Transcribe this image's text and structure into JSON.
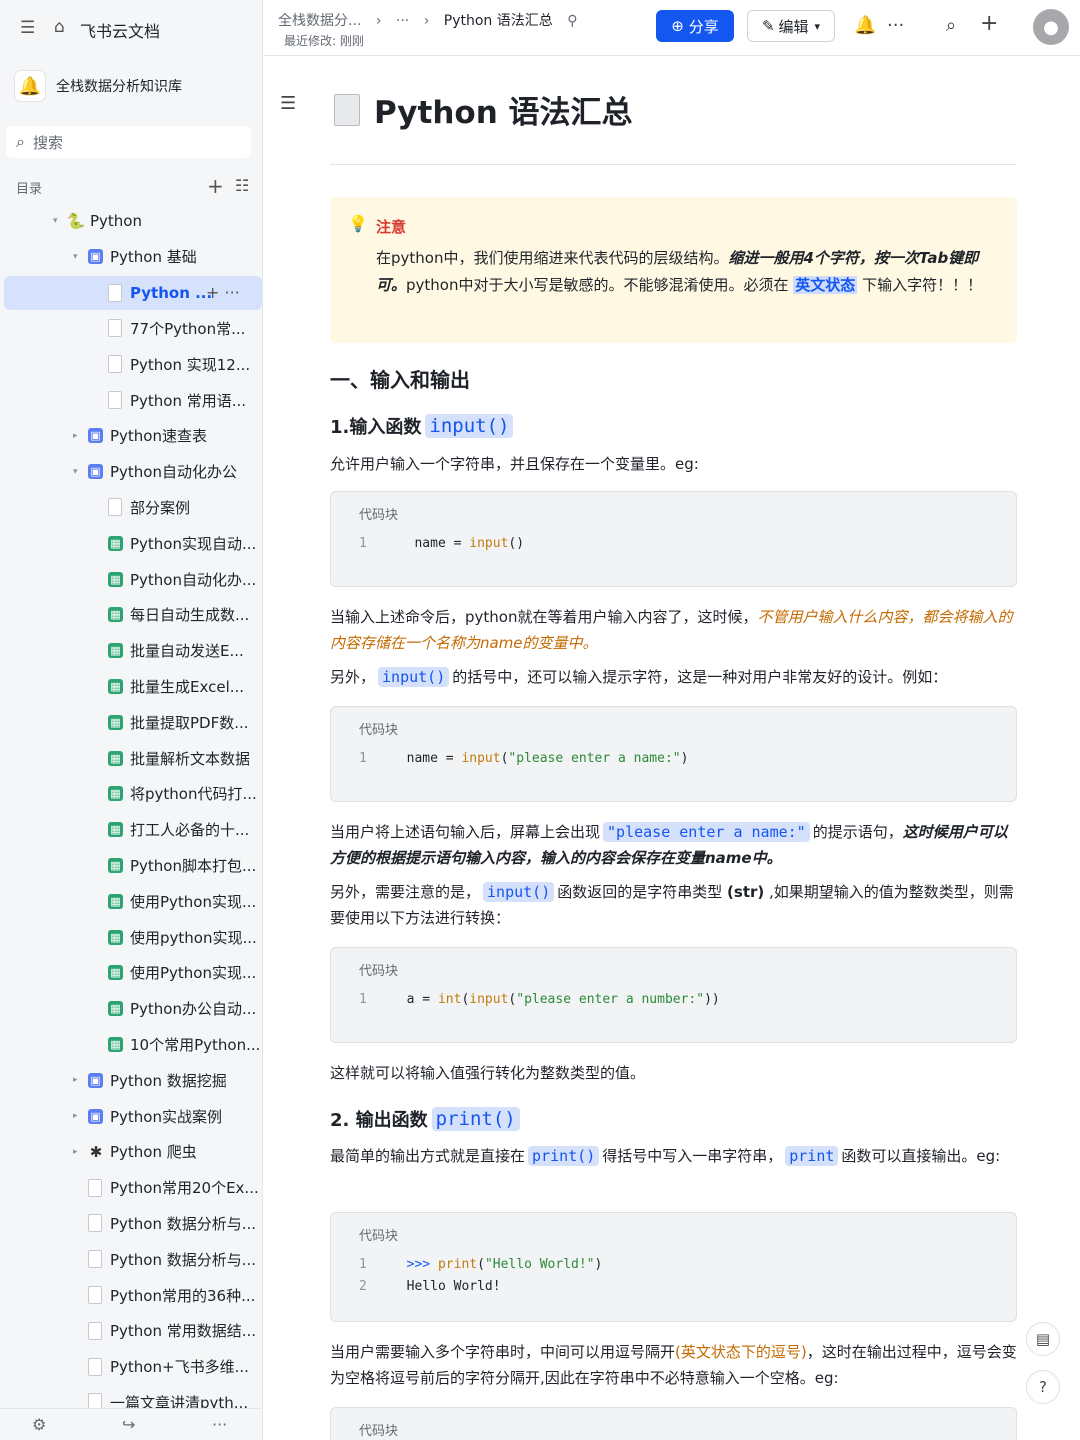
{
  "sidebar": {
    "app_title": "飞书云文档",
    "knowledge_base": "全栈数据分析知识库",
    "search_placeholder": "搜索",
    "toc_label": "目录",
    "tree": [
      {
        "label": "Python",
        "depth": 0,
        "caret": "▾",
        "icon": "snake"
      },
      {
        "label": "Python 基础",
        "depth": 1,
        "caret": "▾",
        "icon": "wiki"
      },
      {
        "label": "Python ...",
        "depth": 2,
        "caret": "",
        "icon": "doc",
        "selected": true
      },
      {
        "label": "77个Python常...",
        "depth": 2,
        "caret": "",
        "icon": "doc"
      },
      {
        "label": "Python 实现12...",
        "depth": 2,
        "caret": "",
        "icon": "doc"
      },
      {
        "label": "Python 常用语...",
        "depth": 2,
        "caret": "",
        "icon": "doc"
      },
      {
        "label": "Python速查表",
        "depth": 1,
        "caret": "▸",
        "icon": "wiki"
      },
      {
        "label": "Python自动化办公",
        "depth": 1,
        "caret": "▾",
        "icon": "wiki"
      },
      {
        "label": "部分案例",
        "depth": 2,
        "caret": "",
        "icon": "doc"
      },
      {
        "label": "Python实现自动...",
        "depth": 2,
        "caret": "",
        "icon": "sheet"
      },
      {
        "label": "Python自动化办...",
        "depth": 2,
        "caret": "",
        "icon": "sheet"
      },
      {
        "label": "每日自动生成数...",
        "depth": 2,
        "caret": "",
        "icon": "sheet"
      },
      {
        "label": "批量自动发送E...",
        "depth": 2,
        "caret": "",
        "icon": "sheet"
      },
      {
        "label": "批量生成Excel...",
        "depth": 2,
        "caret": "",
        "icon": "sheet"
      },
      {
        "label": "批量提取PDF数...",
        "depth": 2,
        "caret": "",
        "icon": "sheet"
      },
      {
        "label": "批量解析文本数据",
        "depth": 2,
        "caret": "",
        "icon": "sheet"
      },
      {
        "label": "将python代码打...",
        "depth": 2,
        "caret": "",
        "icon": "sheet"
      },
      {
        "label": "打工人必备的十...",
        "depth": 2,
        "caret": "",
        "icon": "sheet"
      },
      {
        "label": "Python脚本打包...",
        "depth": 2,
        "caret": "",
        "icon": "sheet"
      },
      {
        "label": "使用Python实现...",
        "depth": 2,
        "caret": "",
        "icon": "sheet"
      },
      {
        "label": "使用python实现...",
        "depth": 2,
        "caret": "",
        "icon": "sheet"
      },
      {
        "label": "使用Python实现...",
        "depth": 2,
        "caret": "",
        "icon": "sheet"
      },
      {
        "label": "Python办公自动...",
        "depth": 2,
        "caret": "",
        "icon": "sheet"
      },
      {
        "label": "10个常用Python...",
        "depth": 2,
        "caret": "",
        "icon": "sheet"
      },
      {
        "label": "Python 数据挖掘",
        "depth": 1,
        "caret": "▸",
        "icon": "wiki"
      },
      {
        "label": "Python实战案例",
        "depth": 1,
        "caret": "▸",
        "icon": "wiki"
      },
      {
        "label": "Python 爬虫",
        "depth": 1,
        "caret": "▸",
        "icon": "spider"
      },
      {
        "label": "Python常用20个Ex...",
        "depth": 1,
        "caret": "",
        "icon": "doc"
      },
      {
        "label": "Python 数据分析与...",
        "depth": 1,
        "caret": "",
        "icon": "doc"
      },
      {
        "label": "Python 数据分析与...",
        "depth": 1,
        "caret": "",
        "icon": "doc"
      },
      {
        "label": "Python常用的36种...",
        "depth": 1,
        "caret": "",
        "icon": "doc"
      },
      {
        "label": "Python 常用数据结...",
        "depth": 1,
        "caret": "",
        "icon": "doc"
      },
      {
        "label": "Python+飞书多维...",
        "depth": 1,
        "caret": "",
        "icon": "doc"
      },
      {
        "label": "一篇文章讲清pyth...",
        "depth": 1,
        "caret": "",
        "icon": "doc"
      }
    ]
  },
  "topbar": {
    "crumb_root": "全栈数据分...",
    "crumb_sep": "›",
    "crumb_more": "···",
    "crumb_current": "Python 语法汇总",
    "modified": "最近修改: 刚刚",
    "share_label": "分享",
    "edit_label": "编辑"
  },
  "doc": {
    "title": "Python 语法汇总",
    "callout_title": "注意",
    "callout_p1": "在python中，我们使用缩进来代表代码的层级结构。",
    "callout_em": "缩进一般用4个字符，按一次Tab键即可。",
    "callout_p2": "python中对于大小写是敏感的。不能够混淆使用。必须在",
    "callout_hl": "英文状态",
    "callout_p3": "下输入字符！！！",
    "h2_1": "一、输入和输出",
    "h3_1_text": "1.输入函数",
    "h3_1_code": "input()",
    "p1": "允许用户输入一个字符串，并且保存在一个变量里。eg:",
    "code_label": "代码块",
    "code1": [
      {
        "n": "1",
        "t": "name = input()"
      }
    ],
    "p2a": "当输入上述命令后，python就在等着用户输入内容了，这时候，",
    "p2b": "不管用户输入什么内容，都会将输入的内容存储在一个名称为name的变量中。",
    "p3a": "另外，",
    "p3code": "input()",
    "p3b": "的括号中，还可以输入提示字符，这是一种对用户非常友好的设计。例如：",
    "code2": [
      {
        "n": "1",
        "t": "name = input(\"please enter a name:\")"
      }
    ],
    "p4a": "当用户将上述语句输入后，屏幕上会出现",
    "p4code": "\"please enter a name:\"",
    "p4b": "的提示语句，",
    "p4c": "这时候用户可以方便的根据提示语句输入内容，输入的内容会保存在变量name中。",
    "p5a": "另外，需要注意的是，",
    "p5code": "input()",
    "p5b": "函数返回的是字符串类型",
    "p5c": "(str)",
    "p5d": ",如果期望输入的值为整数类型，则需要使用以下方法进行转换：",
    "code3": [
      {
        "n": "1",
        "t": "a = int(input(\"please enter a number:\"))"
      }
    ],
    "p6": "这样就可以将输入值强行转化为整数类型的值。",
    "h3_2_text": "2. 输出函数",
    "h3_2_code": "print()",
    "p7a": "最简单的输出方式就是直接在",
    "p7code": "print()",
    "p7b": "得括号中写入一串字符串，",
    "p7code2": "print",
    "p7c": "函数可以直接输出。eg:",
    "code4": [
      {
        "n": "1",
        "t": ">>> print(\"Hello World!\")"
      },
      {
        "n": "2",
        "t": "Hello World!"
      }
    ],
    "p8a": "当用户需要输入多个字符串时，中间可以用逗号隔开",
    "p8b": "(英文状态下的逗号)",
    "p8c": "，这时在输出过程中，逗号会变为空格将逗号前后的字符分隔开,因此在字符串中不必特意输入一个空格。eg:"
  }
}
